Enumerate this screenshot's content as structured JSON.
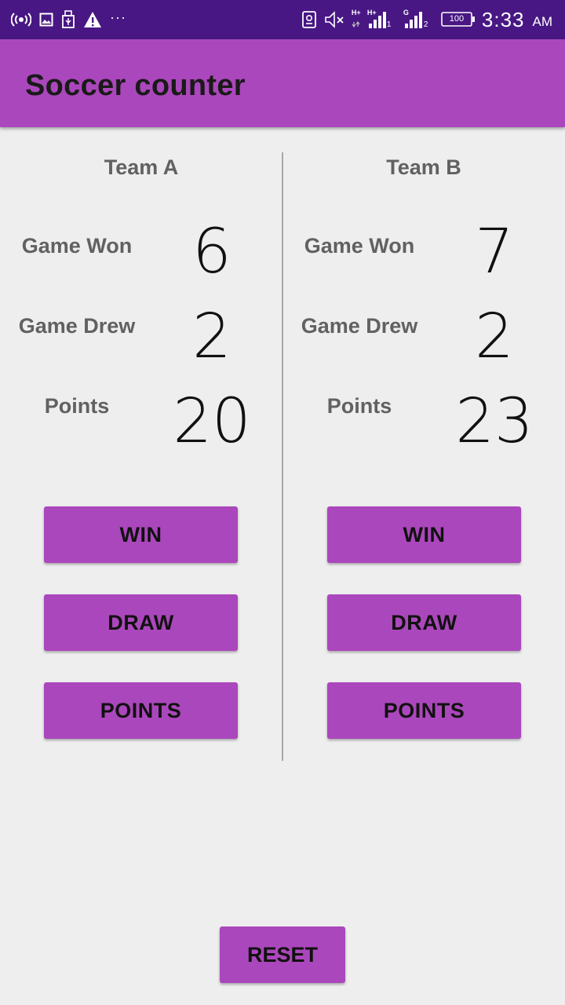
{
  "status_bar": {
    "left_icons": [
      "hotspot-icon",
      "image-icon",
      "usb-icon",
      "warning-icon"
    ],
    "overflow": "···",
    "right_icons": [
      "screenshot-icon",
      "mute-icon",
      "signal-sim1-icon",
      "signal-sim2-icon",
      "battery-icon"
    ],
    "network_sim1": "H+",
    "network_sim1_b": "H+",
    "sim1_index": "1",
    "network_sim2": "G",
    "sim2_index": "2",
    "battery_level": "100",
    "time": "3:33",
    "ampm": "AM"
  },
  "app_bar": {
    "title": "Soccer counter"
  },
  "teams": [
    {
      "name": "Team A",
      "won_label": "Game Won",
      "won_value": "6",
      "drew_label": "Game Drew",
      "drew_value": "2",
      "points_label": "Points",
      "points_value": "20",
      "win_button": "WIN",
      "draw_button": "DRAW",
      "points_button": "POINTS"
    },
    {
      "name": "Team B",
      "won_label": "Game Won",
      "won_value": "7",
      "drew_label": "Game Drew",
      "drew_value": "2",
      "points_label": "Points",
      "points_value": "23",
      "win_button": "WIN",
      "draw_button": "DRAW",
      "points_button": "POINTS"
    }
  ],
  "reset_button": "RESET",
  "colors": {
    "status_bar": "#481784",
    "accent": "#ab47bc",
    "background": "#eeeeee",
    "label_text": "#616161",
    "divider": "#a8a8a8"
  }
}
